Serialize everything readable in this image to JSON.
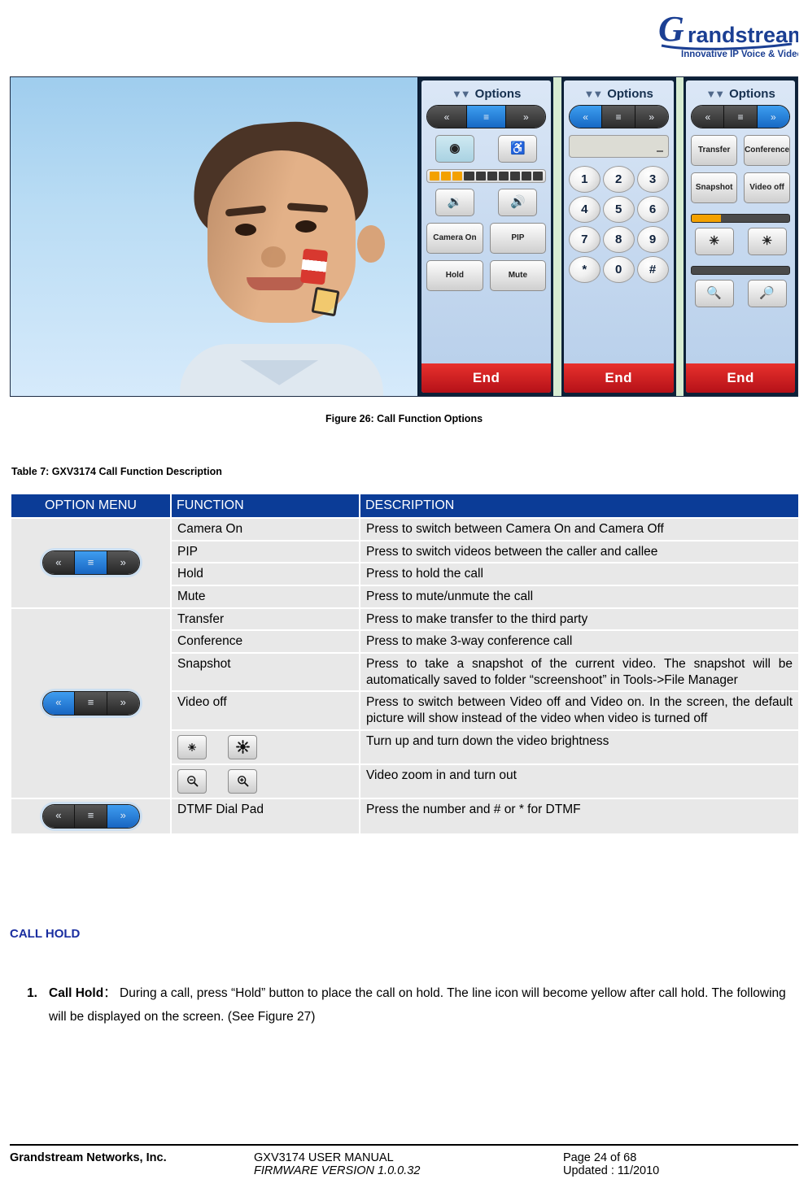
{
  "header": {
    "logo_text": "Grandstream",
    "logo_tagline": "Innovative IP Voice & Video"
  },
  "figure": {
    "caption": "Figure 26: Call Function Options",
    "panels": [
      {
        "title": "Options",
        "chevron_icon": "chevron-down-icon",
        "pill": {
          "left": "«",
          "middle": "≡",
          "right": "»",
          "active": "middle"
        },
        "buttons": [
          "Camera On",
          "PIP",
          "Hold",
          "Mute"
        ],
        "icon_buttons": [
          "camera-icon",
          "headset-icon",
          "speaker-low-icon",
          "speaker-high-icon"
        ],
        "volume_lit": 3,
        "volume_total": 10,
        "end_label": "End"
      },
      {
        "title": "Options",
        "chevron_icon": "chevron-down-icon",
        "pill": {
          "left": "«",
          "middle": "≡",
          "right": "»",
          "active": "left"
        },
        "input_value": "",
        "keys": [
          "1",
          "2",
          "3",
          "4",
          "5",
          "6",
          "7",
          "8",
          "9",
          "*",
          "0",
          "#"
        ],
        "end_label": "End"
      },
      {
        "title": "Options",
        "chevron_icon": "chevron-down-icon",
        "pill": {
          "left": "«",
          "middle": "≡",
          "right": "»",
          "active": "right"
        },
        "buttons": [
          "Transfer",
          "Conference",
          "Snapshot",
          "Video off"
        ],
        "brightness_percent": 30,
        "zoom_percent": 0,
        "icon_buttons": [
          "brightness-down-icon",
          "brightness-up-icon",
          "zoom-out-icon",
          "zoom-in-icon"
        ],
        "end_label": "End"
      }
    ]
  },
  "table": {
    "title": "Table 7: GXV3174 Call Function Description",
    "headers": [
      "OPTION MENU",
      "FUNCTION",
      "DESCRIPTION"
    ],
    "groups": [
      {
        "menu_icon": "option-menu-pill-middle-icon",
        "pill_active": "middle",
        "rows": [
          {
            "function": "Camera On",
            "description": "Press to switch between Camera On and Camera Off"
          },
          {
            "function": "PIP",
            "description": "Press to switch videos between the caller and callee"
          },
          {
            "function": "Hold",
            "description": "Press to hold the call"
          },
          {
            "function": "Mute",
            "description": "Press to mute/unmute the call"
          }
        ]
      },
      {
        "menu_icon": "option-menu-pill-left-icon",
        "pill_active": "left",
        "rows": [
          {
            "function": "Transfer",
            "description": "Press to make transfer to the third party"
          },
          {
            "function": "Conference",
            "description": "Press to make 3-way conference call"
          },
          {
            "function": "Snapshot",
            "description": "Press to take a snapshot of the current video. The snapshot will be automatically saved to folder “screenshoot” in Tools->File Manager"
          },
          {
            "function": "Video off",
            "description": "Press to switch between Video off and Video on. In the screen, the default picture will show instead of the video when video is turned off"
          },
          {
            "function_icons": [
              "brightness-down-icon",
              "brightness-up-icon"
            ],
            "description": "Turn up and turn down the video brightness"
          },
          {
            "function_icons": [
              "zoom-out-icon",
              "zoom-in-icon"
            ],
            "description": "Video zoom in and turn out"
          }
        ]
      },
      {
        "menu_icon": "option-menu-pill-right-icon",
        "pill_active": "right",
        "rows": [
          {
            "function": "DTMF Dial Pad",
            "description": "Press the number and # or * for DTMF"
          }
        ]
      }
    ]
  },
  "section": {
    "heading": "CALL HOLD",
    "items": [
      {
        "number": "1.",
        "bold_lead": "Call Hold",
        "separator": "：",
        "text": "During a call, press “Hold” button to place the call on hold. The line icon will become yellow after call hold. The following will be displayed on the screen. (See Figure 27)"
      }
    ]
  },
  "footer": {
    "company": "Grandstream Networks, Inc.",
    "manual": "GXV3174 USER MANUAL",
    "firmware": "FIRMWARE VERSION 1.0.0.32",
    "page": "Page 24 of 68",
    "updated": "Updated : 11/2010"
  },
  "colors": {
    "table_header_blue": "#0b3c97",
    "heading_blue": "#1a2ea0",
    "row_gray": "#e8e8e8",
    "end_red": "#d2211f",
    "accent_amber": "#f3a100"
  }
}
